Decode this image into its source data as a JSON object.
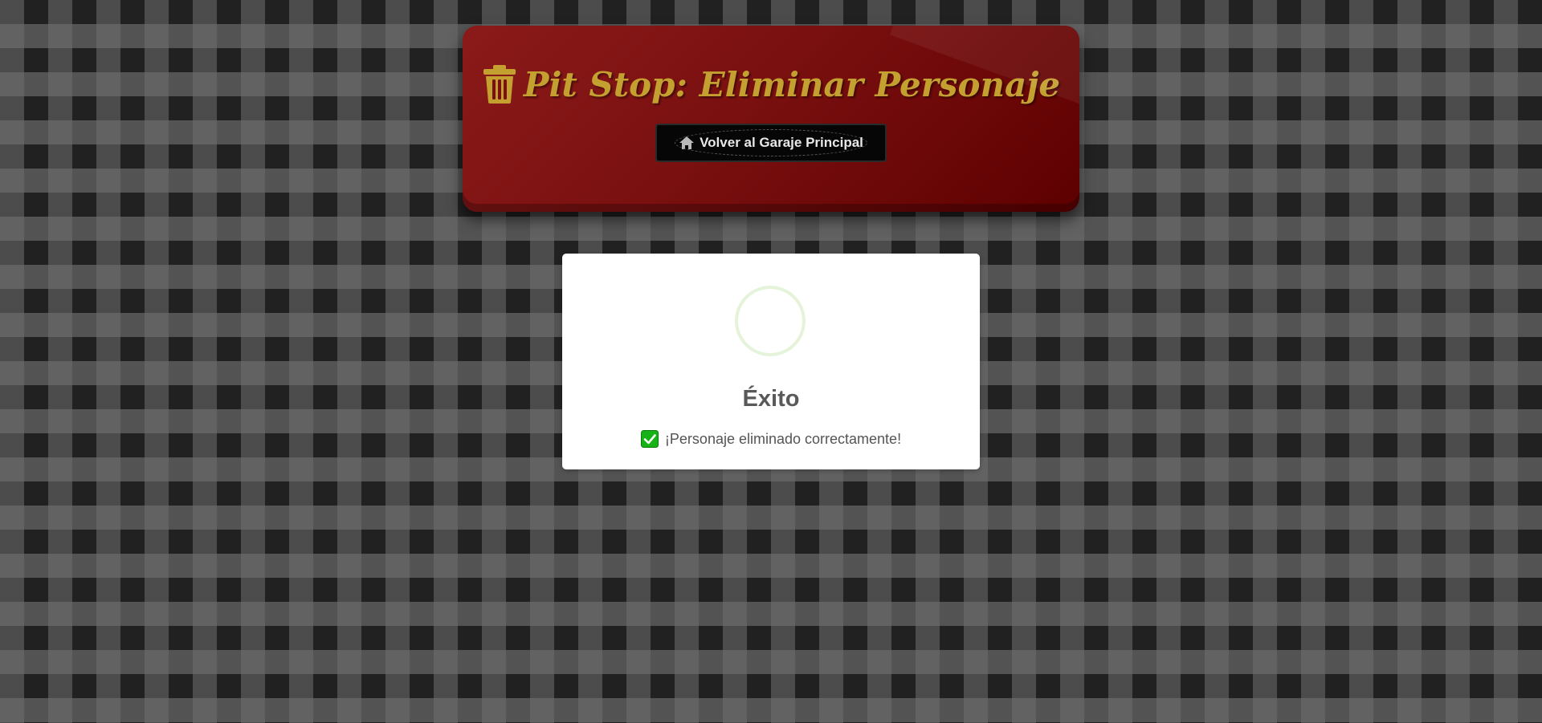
{
  "header": {
    "title": "Pit Stop: Eliminar Personaje",
    "title_icon": "trash-icon",
    "home_button": {
      "label": "Volver al Garaje Principal",
      "icon": "home-icon"
    }
  },
  "modal": {
    "title": "Éxito",
    "message": "¡Personaje eliminado correctamente!",
    "message_icon": "check-mark-icon"
  },
  "colors": {
    "header_background": "#7a1010",
    "title_gold": "#c4a030",
    "button_background": "#060606",
    "success_ring": "#e4f3d9",
    "check_green": "#16b316"
  }
}
